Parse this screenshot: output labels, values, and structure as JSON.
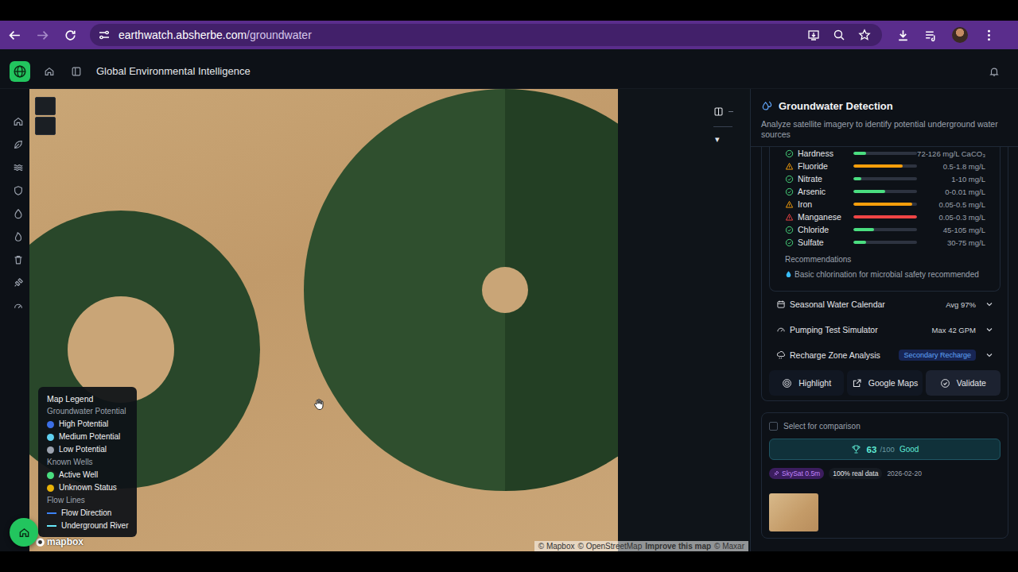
{
  "browser": {
    "url_host": "earthwatch.absherbe.com",
    "url_path": "/groundwater"
  },
  "app": {
    "title": "Global Environmental Intelligence"
  },
  "map": {
    "legend": {
      "title": "Map Legend",
      "sections": [
        {
          "title": "Groundwater Potential",
          "items": [
            {
              "label": "High Potential",
              "kind": "dot",
              "color": "#3b6fe6"
            },
            {
              "label": "Medium Potential",
              "kind": "dot",
              "color": "#5fd0f0"
            },
            {
              "label": "Low Potential",
              "kind": "dot",
              "color": "#9ca3af"
            }
          ]
        },
        {
          "title": "Known Wells",
          "items": [
            {
              "label": "Active Well",
              "kind": "dot",
              "color": "#4ade80"
            },
            {
              "label": "Unknown Status",
              "kind": "dot",
              "color": "#eab308"
            }
          ]
        },
        {
          "title": "Flow Lines",
          "items": [
            {
              "label": "Flow Direction",
              "kind": "line",
              "color": "#3b82f6"
            },
            {
              "label": "Underground River",
              "kind": "line",
              "color": "#67e8f9"
            }
          ]
        }
      ]
    },
    "logo": "mapbox",
    "attribution": [
      {
        "text": "© Mapbox",
        "bold": false
      },
      {
        "text": "© OpenStreetMap",
        "bold": false
      },
      {
        "text": "Improve this map",
        "bold": true
      },
      {
        "text": "© Maxar",
        "bold": false
      }
    ]
  },
  "side_controls": {
    "chevron": "▾"
  },
  "panel": {
    "title": "Groundwater Detection",
    "description": "Analyze satellite imagery to identify potential underground water sources",
    "quality": [
      {
        "name": "Hardness",
        "kind": "ok",
        "color": "#4ade80",
        "level": 0.2,
        "range": "72-126 mg/L CaCO₃"
      },
      {
        "name": "Fluoride",
        "kind": "warning",
        "color": "#f59e0b",
        "level": 0.78,
        "range": "0.5-1.8 mg/L"
      },
      {
        "name": "Nitrate",
        "kind": "ok",
        "color": "#4ade80",
        "level": 0.12,
        "range": "1-10 mg/L"
      },
      {
        "name": "Arsenic",
        "kind": "ok",
        "color": "#4ade80",
        "level": 0.5,
        "range": "0-0.01 mg/L"
      },
      {
        "name": "Iron",
        "kind": "warning",
        "color": "#f59e0b",
        "level": 0.92,
        "range": "0.05-0.5 mg/L"
      },
      {
        "name": "Manganese",
        "kind": "warning",
        "color": "#ef4444",
        "level": 1.0,
        "range": "0.05-0.3 mg/L"
      },
      {
        "name": "Chloride",
        "kind": "ok",
        "color": "#4ade80",
        "level": 0.32,
        "range": "45-105 mg/L"
      },
      {
        "name": "Sulfate",
        "kind": "ok",
        "color": "#4ade80",
        "level": 0.2,
        "range": "30-75 mg/L"
      }
    ],
    "recommendations": {
      "title": "Recommendations",
      "items": [
        "Basic chlorination for microbial safety recommended"
      ]
    },
    "sections": [
      {
        "label": "Seasonal Water Calendar",
        "value": "Avg 97%",
        "kind": "text",
        "expanded": false
      },
      {
        "label": "Pumping Test Simulator",
        "value": "Max 42 GPM",
        "kind": "text",
        "expanded": false
      },
      {
        "label": "Recharge Zone Analysis",
        "value": "Secondary Recharge",
        "kind": "badge",
        "expanded": false
      }
    ],
    "actions": [
      "Highlight",
      "Google Maps",
      "Validate"
    ],
    "result": {
      "compare": {
        "label": "Select for comparison",
        "checked": false
      },
      "score": {
        "value": "63",
        "max": "/100",
        "rating": "Good"
      },
      "tags": [
        {
          "label": "SkySat 0.5m",
          "kind": "satellite",
          "color": "#c084fc"
        },
        {
          "label": "100% real data",
          "kind": "plain",
          "color": "#e5e7eb"
        }
      ],
      "date": "2026-02-20"
    }
  }
}
